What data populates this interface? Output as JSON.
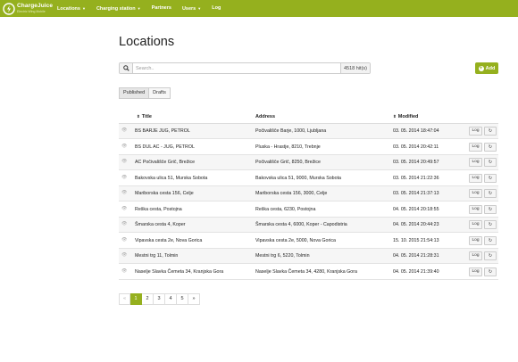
{
  "nav": {
    "brand_name": "ChargeJuice",
    "brand_tagline": "Electric Wing Mobile",
    "items": [
      {
        "label": "Locations",
        "dropdown": true
      },
      {
        "label": "Charging station",
        "dropdown": true
      },
      {
        "label": "Partners",
        "dropdown": false
      },
      {
        "label": "Users",
        "dropdown": true
      },
      {
        "label": "Log",
        "dropdown": false
      }
    ],
    "accent_color": "#95b01e"
  },
  "page_title": "Locations",
  "search": {
    "placeholder": "Search..",
    "value": "",
    "hits": "4518 hit(s)",
    "icon": "search-icon"
  },
  "add_button": {
    "label": "Add",
    "icon": "plus-circle-icon"
  },
  "filter_tabs": [
    "Published",
    "Drafts"
  ],
  "table": {
    "headers": {
      "title": "Title",
      "address": "Address",
      "modified": "Modified"
    },
    "row_buttons": {
      "log": "Log",
      "refresh_icon": "refresh-icon"
    },
    "rows": [
      {
        "title": "BS BARJE JUG, PETROL",
        "address": "Počivališče Barje, 1000, Ljubljana",
        "modified": "03. 05. 2014 18:47:04"
      },
      {
        "title": "BS DUL AC - JUG, PETROL",
        "address": "Pluska - Hrastje, 8210, Trebnje",
        "modified": "03. 05. 2014 20:42:11"
      },
      {
        "title": "AC Počivališče Grič, Brežice",
        "address": "Počivališče Grič, 8250, Brežice",
        "modified": "03. 05. 2014 20:49:57"
      },
      {
        "title": "Bakovska ulica 51, Murska Sobota",
        "address": "Bakovska ulica 51, 9000, Murska Sobota",
        "modified": "03. 05. 2014 21:22:36"
      },
      {
        "title": "Mariborska cesta 156, Celje",
        "address": "Mariborska cesta 156, 3000, Celje",
        "modified": "03. 05. 2014 21:37:13"
      },
      {
        "title": "Reška cesta, Postojna",
        "address": "Reška cesta, 6230, Postojna",
        "modified": "04. 05. 2014 20:18:55"
      },
      {
        "title": "Šmarska cesta 4, Koper",
        "address": "Šmarska cesta 4, 6000, Koper - Capodistria",
        "modified": "04. 05. 2014 20:44:23"
      },
      {
        "title": "Vipavska cesta 2e, Nova Gorica",
        "address": "Vipavska cesta 2e, 5000, Nova Gorica",
        "modified": "15. 10. 2015 21:54:13"
      },
      {
        "title": "Mestni trg 11, Tolmin",
        "address": "Mestni trg 6, 5220, Tolmin",
        "modified": "04. 05. 2014 21:28:31"
      },
      {
        "title": "Naselje Slavka Čemeta 34, Kranjska Gora",
        "address": "Naselje Slavka Čemeta 34, 4280, Kranjska Gora",
        "modified": "04. 05. 2014 21:39:40"
      }
    ]
  },
  "pagination": {
    "prev": "«",
    "pages": [
      "1",
      "2",
      "3",
      "4",
      "5"
    ],
    "current": "1",
    "next": "»"
  }
}
